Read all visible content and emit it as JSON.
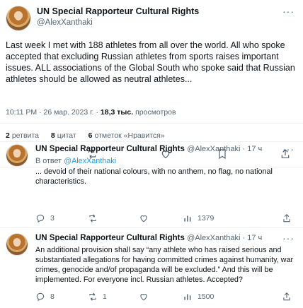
{
  "main_tweet": {
    "display_name": "UN Special Rapporteur Cultural Rights",
    "handle": "@AlexXanthaki",
    "more_icon": "···",
    "text": "Last week I met with 188 athletes from all over the world. All who spoke accepted that excluding Russian athletes from sports raises important issues. ALL associations of the Global South who spoke said that Russian athletes should be allowed as neutral athletes...",
    "time": "10:11 PM · 26 мар. 2023 г.",
    "sep": " · ",
    "views_count": "18,3 тыс.",
    "views_label": " просмотров",
    "stats": {
      "retweets_count": "2",
      "retweets_label": "ретвита",
      "quotes_count": "8",
      "quotes_label": "цитат",
      "likes_count": "6",
      "likes_label": "отметок «Нравится»"
    }
  },
  "replies": [
    {
      "display_name": "UN Special Rapporteur Cultural Rights",
      "handle": "@AlexXanthaki",
      "time": "17 ч",
      "reply_to_label": "В ответ ",
      "reply_to_handle": "@AlexXanthaki",
      "text": "... devoid of their national colours, with no anthem, no flag, no national characteristics.",
      "replies_count": "3",
      "retweets_count": "",
      "likes_count": "",
      "views_count": "1379"
    },
    {
      "display_name": "UN Special Rapporteur Cultural Rights",
      "handle": "@AlexXanthaki",
      "time": "17 ч",
      "text": "An additional provision shall say “any athlete who has raised serious and substantiated allegations for having committed crimes against humanity, war crimes, genocide and/of propaganda will be excluded.” And this will be implemented. For everyone incl. Russian athletes. Accepted?",
      "replies_count": "8",
      "retweets_count": "1",
      "likes_count": "",
      "views_count": "1500"
    }
  ],
  "icons": [
    "reply-icon",
    "retweet-icon",
    "like-icon",
    "bookmark-icon",
    "share-icon",
    "views-icon",
    "more-icon"
  ],
  "colors": {
    "text": "#0f1419",
    "secondary": "#536471",
    "link": "#1d9bf0",
    "divider": "#eff3f4"
  }
}
